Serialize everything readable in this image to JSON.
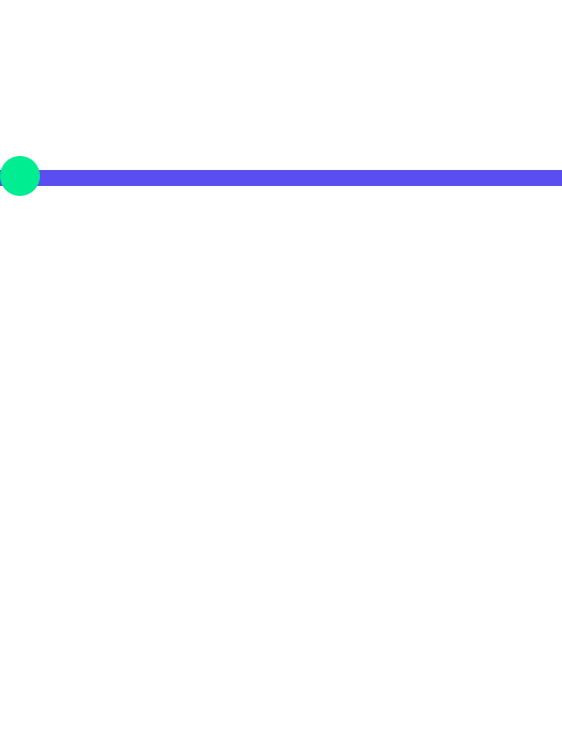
{
  "slider": {
    "value_fraction": 0.0,
    "colors": {
      "track": "#5b4ef0",
      "thumb": "#00ed92",
      "background": "#ffffff"
    }
  }
}
